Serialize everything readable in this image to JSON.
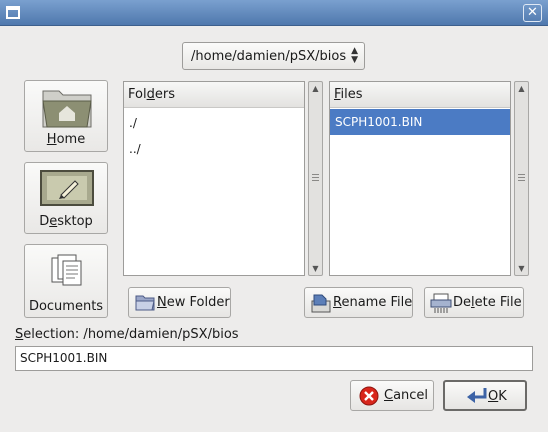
{
  "window": {
    "close_glyph": "✕"
  },
  "path_combo": {
    "value": "/home/damien/pSX/bios"
  },
  "shortcuts": [
    {
      "label_pre": "",
      "mnemonic": "H",
      "label_post": "ome",
      "icon": "home-folder-icon"
    },
    {
      "label_pre": "D",
      "mnemonic": "e",
      "label_post": "sktop",
      "icon": "desktop-icon"
    },
    {
      "label_pre": "Documents",
      "mnemonic": "",
      "label_post": "",
      "icon": "documents-icon"
    }
  ],
  "folders": {
    "header_pre": "Fol",
    "header_mnemonic": "d",
    "header_post": "ers",
    "items": [
      "./",
      "../"
    ]
  },
  "files": {
    "header_pre": "",
    "header_mnemonic": "F",
    "header_post": "iles",
    "items": [
      "SCPH1001.BIN"
    ],
    "selected_index": 0
  },
  "buttons": {
    "new_folder": {
      "mnemonic": "N",
      "rest": "ew Folder"
    },
    "rename_file": {
      "mnemonic": "R",
      "rest": "ename File"
    },
    "delete_file": {
      "pre": "De",
      "mnemonic": "l",
      "rest": "ete File"
    },
    "cancel": {
      "mnemonic": "C",
      "rest": "ancel"
    },
    "ok": {
      "mnemonic": "O",
      "rest": "K"
    }
  },
  "selection": {
    "label_mnemonic": "S",
    "label_rest": "election: /home/damien/pSX/bios",
    "value": "SCPH1001.BIN"
  }
}
